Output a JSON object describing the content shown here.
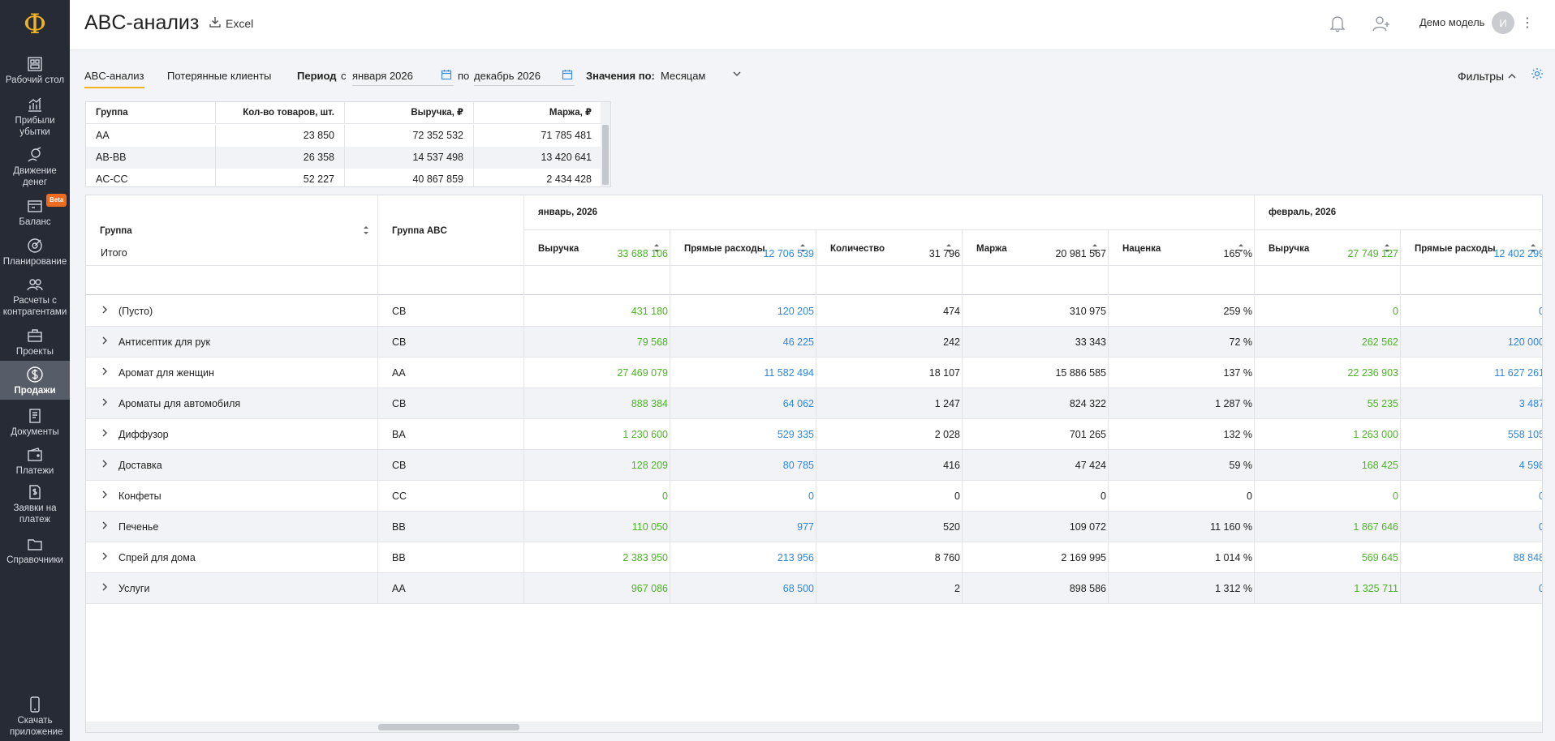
{
  "sidebar": {
    "logo": "Ф",
    "items": [
      {
        "label": "Рабочий стол",
        "icon": "desktop-icon"
      },
      {
        "label": "Прибыли убытки",
        "icon": "chart-bar-icon"
      },
      {
        "label": "Движение денег",
        "icon": "money-flow-icon"
      },
      {
        "label": "Баланс",
        "icon": "balance-icon",
        "badge": "Beta"
      },
      {
        "label": "Планирование",
        "icon": "target-icon"
      },
      {
        "label": "Расчеты с контрагентами",
        "icon": "contractors-icon"
      },
      {
        "label": "Проекты",
        "icon": "briefcase-icon"
      },
      {
        "label": "Продажи",
        "icon": "dollar-icon",
        "active": true
      },
      {
        "label": "Документы",
        "icon": "documents-icon"
      },
      {
        "label": "Платежи",
        "icon": "wallet-icon"
      },
      {
        "label": "Заявки на платеж",
        "icon": "payment-request-icon"
      },
      {
        "label": "Справочники",
        "icon": "folder-icon"
      }
    ],
    "download": "Скачать приложение"
  },
  "header": {
    "title": "ABC-анализ",
    "excel_label": "Excel",
    "user_name": "Демо модель",
    "avatar_letter": "И"
  },
  "toolbar": {
    "tab_abc": "ABC-анализ",
    "tab_lost": "Потерянные клиенты",
    "period_label": "Период",
    "from_label": "с",
    "from_value": "января 2026",
    "to_label": "по",
    "to_value": "декабрь 2026",
    "values_label": "Значения по:",
    "values_value": "Месяцам",
    "filters_label": "Фильтры"
  },
  "summary": {
    "headers": [
      "Группа",
      "Кол-во товаров, шт.",
      "Выручка, ₽",
      "Маржа, ₽"
    ],
    "rows": [
      [
        "AA",
        "23 850",
        "72 352 532",
        "71 785 481"
      ],
      [
        "AB-BB",
        "26 358",
        "14 537 498",
        "13 420 641"
      ],
      [
        "AC-CC",
        "52 227",
        "40 867 859",
        "2 434 428"
      ]
    ]
  },
  "main": {
    "col_group": "Группа",
    "col_abc": "Группа ABC",
    "month1": "январь, 2026",
    "month2": "февраль, 2026",
    "sub_headers": [
      "Выручка",
      "Прямые расходы",
      "Количество",
      "Маржа",
      "Наценка"
    ],
    "total": {
      "label": "Итого",
      "m1": [
        "33 688 106",
        "12 706 539",
        "31 796",
        "20 981 567",
        "165 %"
      ],
      "m2": [
        "27 749 127",
        "12 402 299"
      ]
    },
    "rows": [
      {
        "name": "(Пусто)",
        "abc": "CB",
        "m1": [
          "431 180",
          "120 205",
          "474",
          "310 975",
          "259 %"
        ],
        "m2": [
          "0",
          "0"
        ]
      },
      {
        "name": "Антисептик для рук",
        "abc": "CB",
        "m1": [
          "79 568",
          "46 225",
          "242",
          "33 343",
          "72 %"
        ],
        "m2": [
          "262 562",
          "120 000"
        ]
      },
      {
        "name": "Аромат для женщин",
        "abc": "AA",
        "m1": [
          "27 469 079",
          "11 582 494",
          "18 107",
          "15 886 585",
          "137 %"
        ],
        "m2": [
          "22 236 903",
          "11 627 261"
        ]
      },
      {
        "name": "Ароматы для автомобиля",
        "abc": "CB",
        "m1": [
          "888 384",
          "64 062",
          "1 247",
          "824 322",
          "1 287 %"
        ],
        "m2": [
          "55 235",
          "3 487"
        ]
      },
      {
        "name": "Диффузор",
        "abc": "BA",
        "m1": [
          "1 230 600",
          "529 335",
          "2 028",
          "701 265",
          "132 %"
        ],
        "m2": [
          "1 263 000",
          "558 105"
        ]
      },
      {
        "name": "Доставка",
        "abc": "CB",
        "m1": [
          "128 209",
          "80 785",
          "416",
          "47 424",
          "59 %"
        ],
        "m2": [
          "168 425",
          "4 598"
        ]
      },
      {
        "name": "Конфеты",
        "abc": "CC",
        "m1": [
          "0",
          "0",
          "0",
          "0",
          "0"
        ],
        "m2": [
          "0",
          "0"
        ]
      },
      {
        "name": "Печенье",
        "abc": "BB",
        "m1": [
          "110 050",
          "977",
          "520",
          "109 072",
          "11 160 %"
        ],
        "m2": [
          "1 867 646",
          "0"
        ]
      },
      {
        "name": "Спрей для дома",
        "abc": "BB",
        "m1": [
          "2 383 950",
          "213 956",
          "8 760",
          "2 169 995",
          "1 014 %"
        ],
        "m2": [
          "569 645",
          "88 848"
        ]
      },
      {
        "name": "Услуги",
        "abc": "AA",
        "m1": [
          "967 086",
          "68 500",
          "2",
          "898 586",
          "1 312 %"
        ],
        "m2": [
          "1 325 711",
          "0"
        ]
      }
    ]
  }
}
